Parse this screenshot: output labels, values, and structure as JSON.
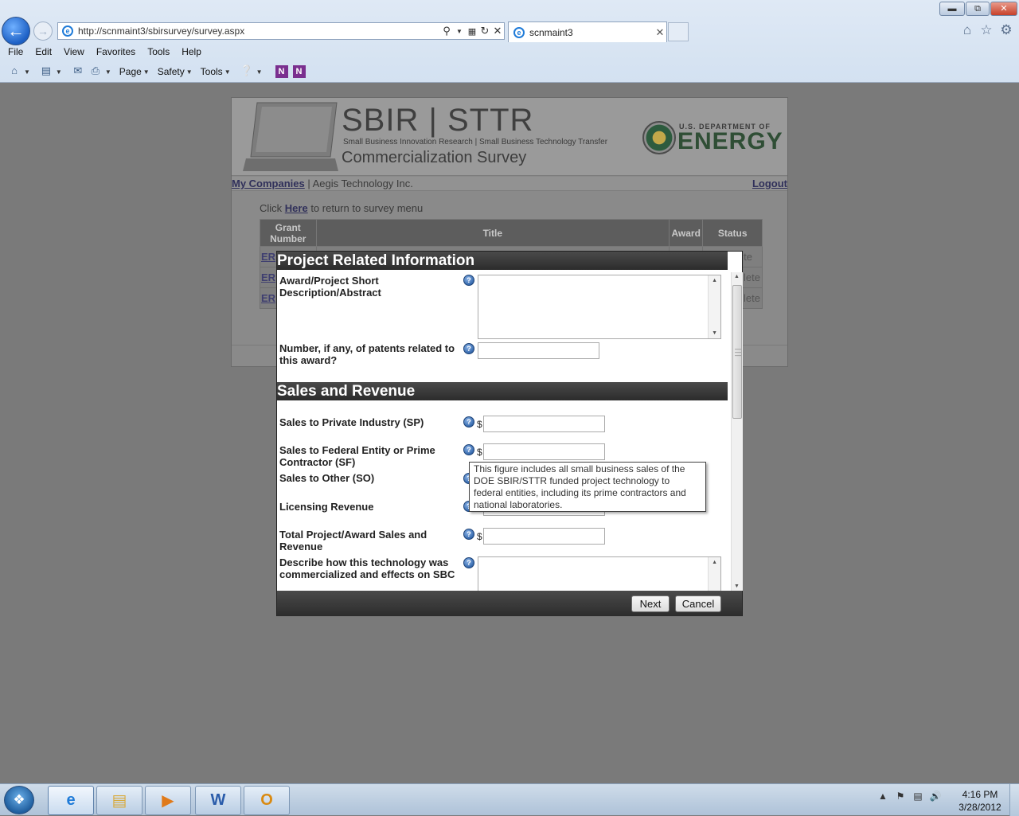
{
  "browser": {
    "url": "http://scnmaint3/sbirsurvey/survey.aspx",
    "tab_title": "scnmaint3",
    "menu": [
      "File",
      "Edit",
      "View",
      "Favorites",
      "Tools",
      "Help"
    ],
    "commands": {
      "page": "Page",
      "safety": "Safety",
      "tools": "Tools"
    }
  },
  "site": {
    "brand_title": "SBIR | STTR",
    "brand_subtitle": "Small Business Innovation Research | Small Business Technology Transfer",
    "brand_survey": "Commercialization Survey",
    "doe_small": "U.S. DEPARTMENT OF",
    "doe_energy": "ENERGY",
    "nav": {
      "my_companies": "My Companies",
      "separator": " | ",
      "company": "Aegis Technology Inc.",
      "logout": "Logout"
    },
    "return_prefix": "Click ",
    "return_link": "Here",
    "return_suffix": " to return to survey menu",
    "table": {
      "headers": {
        "grant": "Grant Number",
        "title": "Title",
        "award": "Award",
        "status": "Status"
      },
      "rows": [
        {
          "grant": "ER",
          "status": "te"
        },
        {
          "grant": "ER",
          "status": "lete"
        },
        {
          "grant": "ER",
          "status": "lete"
        }
      ]
    }
  },
  "modal": {
    "section_project": "Project Related Information",
    "section_sales": "Sales and Revenue",
    "fields": {
      "abstract_label": "Award/Project Short Description/Abstract",
      "patents_label": "Number, if any, of patents related to this award?",
      "sales_private_label": "Sales to Private Industry (SP)",
      "sales_federal_label": "Sales to Federal Entity or Prime Contractor (SF)",
      "sales_other_label": "Sales to Other (SO)",
      "licensing_label": "Licensing Revenue",
      "total_label": "Total Project/Award Sales and Revenue",
      "describe_label": "Describe how this technology was commercialized and effects on SBC",
      "currency": "$",
      "help_glyph": "?"
    },
    "tooltip": "This figure includes all small business sales of the DOE SBIR/STTR funded project technology to federal entities, including its prime contractors and national laboratories.",
    "next": "Next",
    "cancel": "Cancel"
  },
  "taskbar": {
    "time": "4:16 PM",
    "date": "3/28/2012",
    "apps": [
      "internet-explorer",
      "windows-explorer",
      "media-player",
      "word",
      "outlook"
    ]
  }
}
